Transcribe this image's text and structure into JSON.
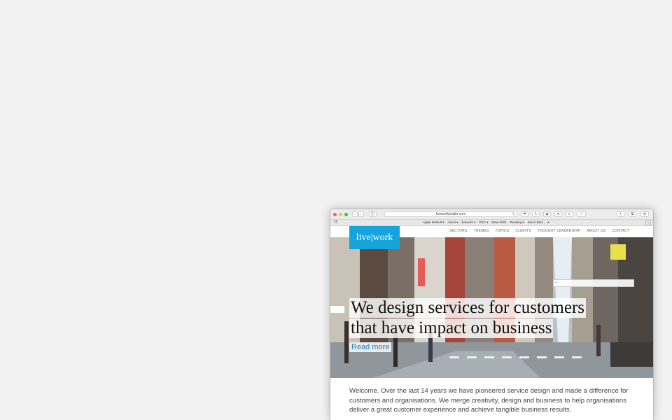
{
  "browser": {
    "url": "liveworkstudio.com",
    "bookmarks": [
      "Apple Default ▾",
      "ruisAt ▾",
      "livework ▾",
      "DSC ▾",
      "Drive DSE",
      "Reading ▾",
      "Servir Bem ... ▾"
    ]
  },
  "site": {
    "logo": "live|work",
    "nav": [
      "SECTORS",
      "THEMES",
      "TOPICS",
      "CLIENTS",
      "THOUGHT LEADERSHIP",
      "ABOUT US",
      "CONTACT"
    ],
    "headline_line1": "We design services for customers",
    "headline_line2": "that have impact on business",
    "read_more": "Read more",
    "welcome": "Welcome. Over the last 14 years we have pioneered service design and made a difference for customers and organisations. We merge creativity, design and business to help organisations deliver a great customer experience and achieve tangible business results."
  },
  "colors": {
    "brand": "#16a4dc",
    "link": "#1b80b8"
  },
  "icons": {
    "sidebar": "sidebar-icon",
    "reload": "reload-icon",
    "search": "search-icon"
  }
}
